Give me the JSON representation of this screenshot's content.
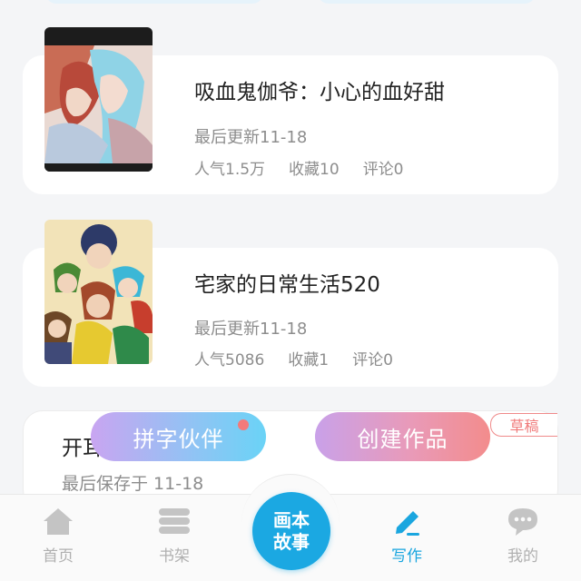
{
  "works": [
    {
      "title": "吸血鬼伽爷：小心的血好甜",
      "updated": "最后更新11-18",
      "popularity": "人气1.5万",
      "favorites": "收藏10",
      "comments": "评论0",
      "cover_icon": "anime-cover-image-1"
    },
    {
      "title": "宅家的日常生活520",
      "updated": "最后更新11-18",
      "popularity": "人气5086",
      "favorites": "收藏1",
      "comments": "评论0",
      "cover_icon": "anime-cover-image-2"
    }
  ],
  "draft": {
    "title": "开耳",
    "saved": "最后保存于 11-18",
    "badge": "草稿"
  },
  "actions": {
    "partner_label": "拼字伙伴",
    "create_label": "创建作品"
  },
  "nav": {
    "home": "首页",
    "shelf": "书架",
    "center_line1": "画本",
    "center_line2": "故事",
    "write": "写作",
    "mine": "我的"
  },
  "colors": {
    "accent": "#1ba8e2",
    "draft_badge": "#f07a7a",
    "notification_dot": "#f37a7a"
  }
}
